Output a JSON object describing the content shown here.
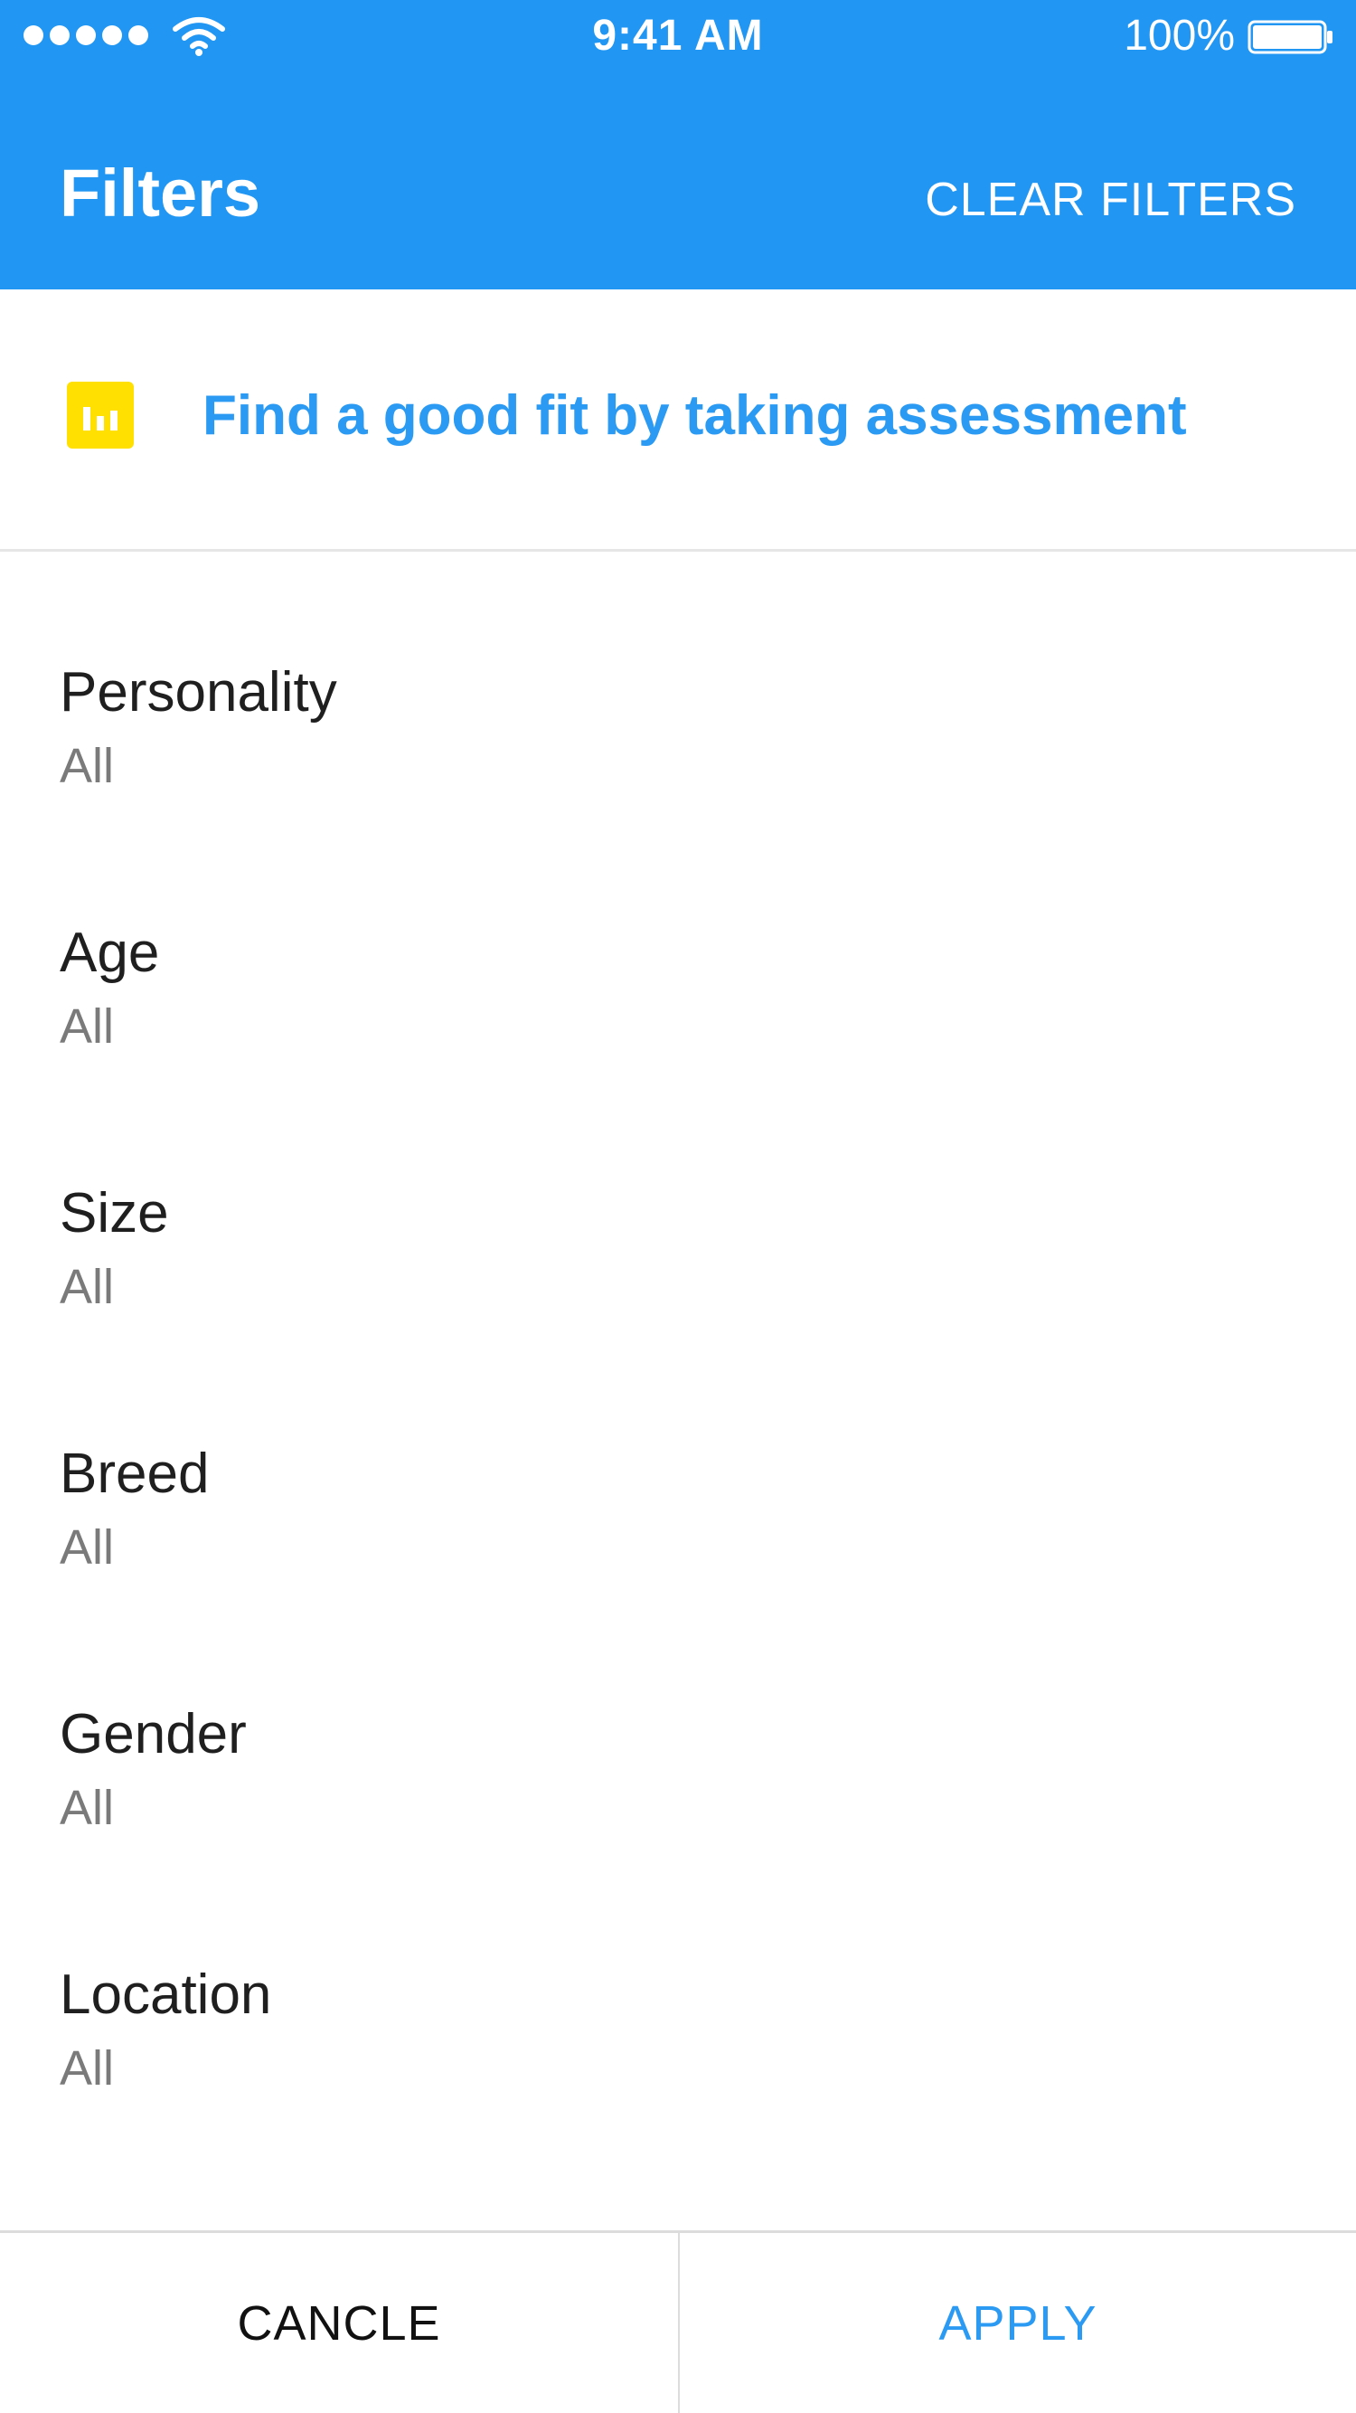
{
  "status_bar": {
    "time": "9:41 AM",
    "battery_percent": "100%",
    "signal_icon": "signal-dots-icon",
    "wifi_icon": "wifi-icon",
    "battery_icon": "battery-icon"
  },
  "header": {
    "title": "Filters",
    "clear_label": "CLEAR FILTERS"
  },
  "assessment": {
    "icon": "bar-chart-icon",
    "text": "Find a good fit by taking assessment"
  },
  "filters": [
    {
      "label": "Personality",
      "value": "All"
    },
    {
      "label": "Age",
      "value": "All"
    },
    {
      "label": "Size",
      "value": "All"
    },
    {
      "label": "Breed",
      "value": "All"
    },
    {
      "label": "Gender",
      "value": "All"
    },
    {
      "label": "Location",
      "value": "All"
    }
  ],
  "footer": {
    "cancel_label": "CANCLE",
    "apply_label": "APPLY"
  },
  "colors": {
    "primary": "#2196f3",
    "accent_text": "#2b9af3",
    "icon_yellow": "#ffe000",
    "secondary_text": "#7a7a7a"
  }
}
